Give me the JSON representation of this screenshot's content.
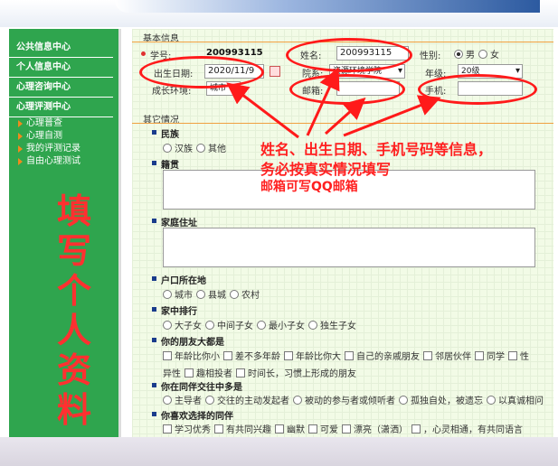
{
  "sidebar": {
    "menus": [
      "公共信息中心",
      "个人信息中心",
      "心理咨询中心",
      "心理评测中心"
    ],
    "sub_items": [
      "心理普查",
      "心理自测",
      "我的评测记录",
      "自由心理测试"
    ],
    "annotation": "填写个人资料"
  },
  "basic": {
    "section_title": "基本信息",
    "student_id_label": "学号:",
    "student_id_value": "200993115",
    "name_label": "姓名:",
    "name_value": "200993115",
    "gender_label": "性别:",
    "gender_options": [
      "男",
      "女"
    ],
    "gender_selected": "男",
    "birth_label": "出生日期:",
    "birth_value": "2020/11/9",
    "dept_label": "院系:",
    "dept_value": "资源环境学院",
    "grade_label": "年级:",
    "grade_value": "20级",
    "env_label": "成长环境:",
    "env_value": "城市",
    "email_label": "邮箱:",
    "email_value": "",
    "phone_label": "手机:",
    "phone_value": ""
  },
  "other": {
    "section_title": "其它情况",
    "nation": {
      "title": "民族",
      "options": [
        "汉族",
        "其他"
      ]
    },
    "origin": {
      "title": "籍贯"
    },
    "address": {
      "title": "家庭住址"
    },
    "hukou": {
      "title": "户口所在地",
      "options": [
        "城市",
        "县城",
        "农村"
      ]
    },
    "rank": {
      "title": "家中排行",
      "options": [
        "大子女",
        "中间子女",
        "最小子女",
        "独生子女"
      ]
    },
    "friends": {
      "title": "你的朋友大都是",
      "options": [
        "年龄比你小",
        "差不多年龄",
        "年龄比你大",
        "自己的亲戚朋友",
        "邻居伙伴",
        "同学",
        "性",
        "异性",
        "趣相投者",
        "时间长，习惯上形成的朋友"
      ]
    },
    "peer_role": {
      "title": "你在同伴交往中多是",
      "options": [
        "主导者",
        "交往的主动发起者",
        "被动的参与者或倾听者",
        "孤独自处，被遗忘",
        "以真诚相问"
      ]
    },
    "favorite": {
      "title": "你喜欢选择的同伴",
      "options": [
        "学习优秀",
        "有共同兴趣",
        "幽默",
        "可爱",
        "漂亮（潇洒）",
        "，心灵相通，有共同语言"
      ]
    }
  },
  "annotation": {
    "line1": "姓名、出生日期、手机号码等信息，",
    "line2": "务必按真实情况填写",
    "line3": "邮箱可写QQ邮箱"
  },
  "colors": {
    "sidebar": "#2fa54e",
    "annotation": "#ff2020",
    "divider": "#f0a040"
  }
}
